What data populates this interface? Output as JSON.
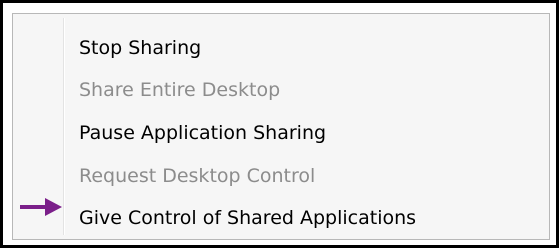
{
  "menu": {
    "items": [
      {
        "label": "Stop Sharing",
        "enabled": true
      },
      {
        "label": "Share Entire Desktop",
        "enabled": false
      },
      {
        "label": "Pause Application Sharing",
        "enabled": true
      },
      {
        "label": "Request Desktop Control",
        "enabled": false
      },
      {
        "label": "Give Control of Shared Applications",
        "enabled": true
      }
    ]
  },
  "annotation": {
    "arrow_icon": "right-arrow-icon",
    "arrow_color": "#7b1f8a"
  },
  "colors": {
    "enabled_text": "#000000",
    "disabled_text": "#8c8c8c",
    "menu_background": "#f6f6f6",
    "frame_border": "#000000"
  }
}
